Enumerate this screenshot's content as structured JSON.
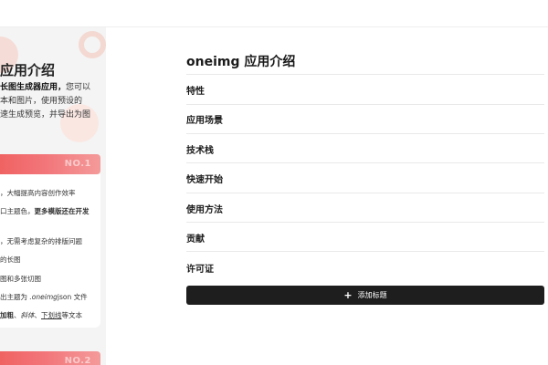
{
  "preview": {
    "title": "应用介绍",
    "intro": {
      "line1_bold": "长图生成器应用，",
      "line1_rest": "您可以",
      "line2": "本和图片，使用预设的",
      "line3": "速生成预览，并导出为图"
    },
    "section1_no": "NO.1",
    "section2_no": "NO.2",
    "feature_lines": [
      {
        "plain": "，大幅提高内容创作效率"
      },
      {
        "plain": "口主题色，",
        "bold": "更多模版还在开发"
      },
      {
        "plain": ""
      },
      {
        "plain": "，无需考虑复杂的排版问题"
      },
      {
        "plain": "的长图"
      },
      {
        "plain": "图和多张切图"
      },
      {
        "plain": "出主题为 ",
        "italic": ".oneimg",
        "tail": "json 文件"
      },
      {
        "bold": "加粗",
        "plain": "、",
        "italic": "斜体",
        "sep": "、",
        "underline": "下划线",
        "tail": "等文本"
      }
    ]
  },
  "outline": {
    "title": "oneimg 应用介绍",
    "items": [
      "特性",
      "应用场景",
      "技术栈",
      "快速开始",
      "使用方法",
      "贡献",
      "许可证"
    ],
    "add_button_icon": "plus-icon",
    "add_button_label": "添加标题"
  }
}
